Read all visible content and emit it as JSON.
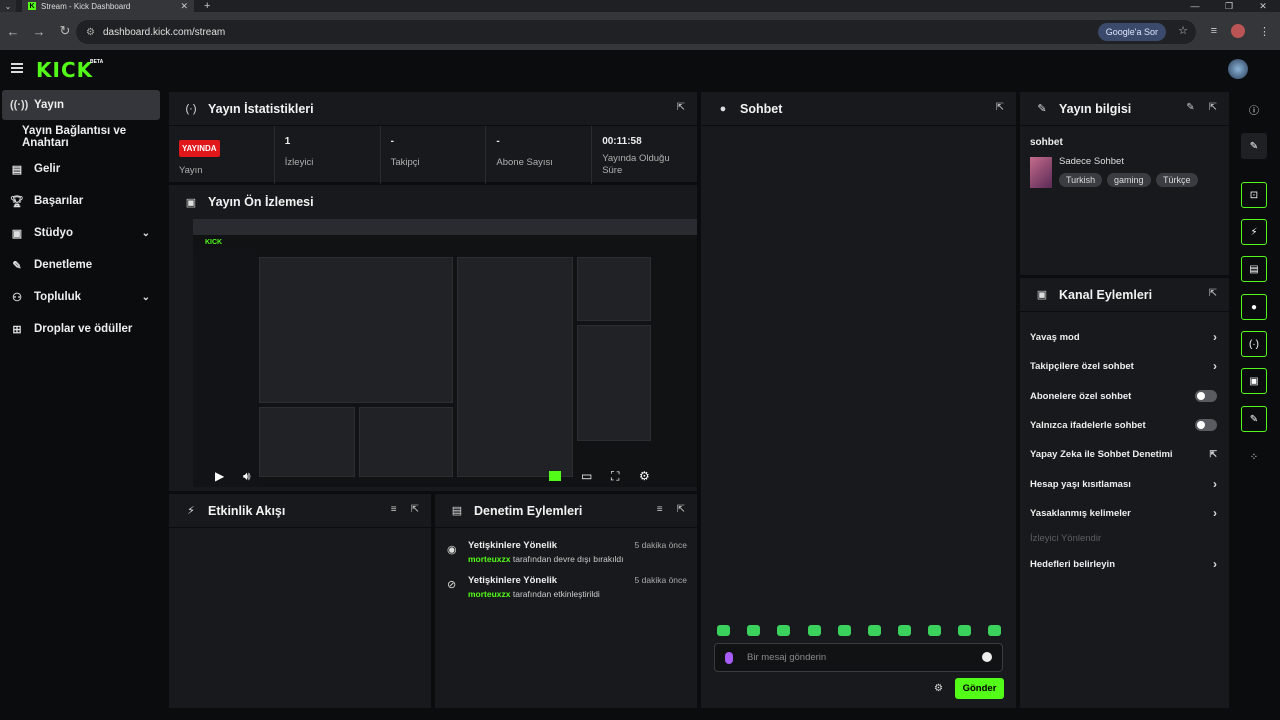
{
  "browser": {
    "tab_title": "Stream - Kick Dashboard",
    "url": "dashboard.kick.com/stream",
    "google_pill": "Google'a Sor"
  },
  "app": {
    "logo": "KICK",
    "beta": "BETA"
  },
  "sidebar": {
    "items": [
      {
        "label": "Yayın",
        "icon": "broadcast-icon",
        "active": true
      },
      {
        "label": "Yayın Bağlantısı ve Anahtarı",
        "sub": true
      },
      {
        "label": "Gelir",
        "icon": "chart-icon"
      },
      {
        "label": "Başarılar",
        "icon": "trophy-icon"
      },
      {
        "label": "Stüdyo",
        "icon": "studio-icon",
        "expandable": true
      },
      {
        "label": "Denetleme",
        "icon": "wrench-icon"
      },
      {
        "label": "Topluluk",
        "icon": "community-icon",
        "expandable": true
      },
      {
        "label": "Droplar ve ödüller",
        "icon": "gift-icon"
      }
    ]
  },
  "stats_panel": {
    "title": "Yayın İstatistikleri",
    "live_badge": "YAYINDA",
    "stats": [
      {
        "value": "",
        "label": "Yayın"
      },
      {
        "value": "1",
        "label": "İzleyici"
      },
      {
        "value": "-",
        "label": "Takipçi"
      },
      {
        "value": "-",
        "label": "Abone Sayısı"
      },
      {
        "value": "00:11:58",
        "label": "Yayında Olduğu Süre"
      }
    ]
  },
  "preview_panel": {
    "title": "Yayın Ön İzlemesi"
  },
  "activity_panel": {
    "title": "Etkinlik Akışı"
  },
  "mod_log_panel": {
    "title": "Denetim Eylemleri",
    "items": [
      {
        "icon": "eye-icon",
        "title": "Yetişkinlere Yönelik",
        "time": "5 dakika önce",
        "user": "morteuxzx",
        "action": "tarafından devre dışı bırakıldı"
      },
      {
        "icon": "eye-off-icon",
        "title": "Yetişkinlere Yönelik",
        "time": "5 dakika önce",
        "user": "morteuxzx",
        "action": "tarafından etkinleştirildi"
      }
    ]
  },
  "chat_panel": {
    "title": "Sohbet",
    "placeholder": "Bir mesaj gönderin",
    "send_label": "Gönder"
  },
  "info_panel": {
    "title": "Yayın bilgisi",
    "stream_title": "sohbet",
    "category": "Sadece Sohbet",
    "tags": [
      "Turkish",
      "gaming",
      "Türkçe"
    ]
  },
  "channel_actions": {
    "title": "Kanal Eylemleri",
    "rows": [
      {
        "label": "Yavaş mod",
        "control": "chevron"
      },
      {
        "label": "Takipçilere özel sohbet",
        "control": "chevron"
      },
      {
        "label": "Abonelere özel sohbet",
        "control": "toggle"
      },
      {
        "label": "Yalnızca ifadelerle sohbet",
        "control": "toggle"
      },
      {
        "label": "Yapay Zeka ile Sohbet Denetimi",
        "control": "external"
      },
      {
        "label": "Hesap yaşı kısıtlaması",
        "control": "chevron"
      },
      {
        "label": "Yasaklanmış kelimeler",
        "control": "chevron"
      },
      {
        "label": "İzleyici Yönlendir",
        "control": "none"
      },
      {
        "label": "Hedefleri belirleyin",
        "control": "chevron"
      }
    ]
  },
  "colors": {
    "accent": "#53fc18",
    "live": "#e0171b",
    "panel": "#18191c"
  }
}
